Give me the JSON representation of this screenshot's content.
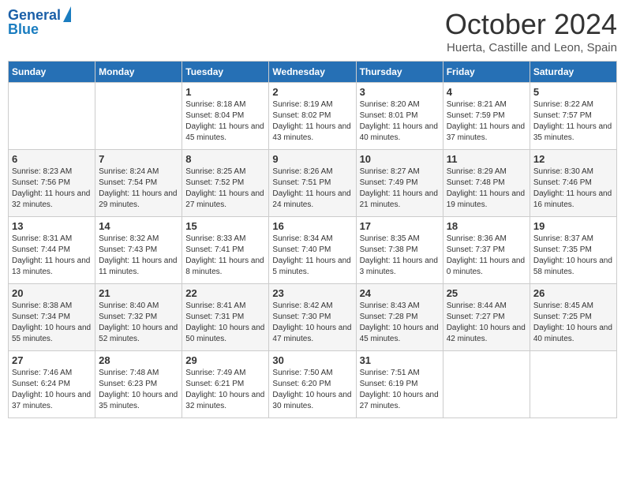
{
  "header": {
    "logo_line1": "General",
    "logo_line2": "Blue",
    "month_title": "October 2024",
    "location": "Huerta, Castille and Leon, Spain"
  },
  "days_of_week": [
    "Sunday",
    "Monday",
    "Tuesday",
    "Wednesday",
    "Thursday",
    "Friday",
    "Saturday"
  ],
  "weeks": [
    [
      {
        "day": "",
        "info": ""
      },
      {
        "day": "",
        "info": ""
      },
      {
        "day": "1",
        "info": "Sunrise: 8:18 AM\nSunset: 8:04 PM\nDaylight: 11 hours and 45 minutes."
      },
      {
        "day": "2",
        "info": "Sunrise: 8:19 AM\nSunset: 8:02 PM\nDaylight: 11 hours and 43 minutes."
      },
      {
        "day": "3",
        "info": "Sunrise: 8:20 AM\nSunset: 8:01 PM\nDaylight: 11 hours and 40 minutes."
      },
      {
        "day": "4",
        "info": "Sunrise: 8:21 AM\nSunset: 7:59 PM\nDaylight: 11 hours and 37 minutes."
      },
      {
        "day": "5",
        "info": "Sunrise: 8:22 AM\nSunset: 7:57 PM\nDaylight: 11 hours and 35 minutes."
      }
    ],
    [
      {
        "day": "6",
        "info": "Sunrise: 8:23 AM\nSunset: 7:56 PM\nDaylight: 11 hours and 32 minutes."
      },
      {
        "day": "7",
        "info": "Sunrise: 8:24 AM\nSunset: 7:54 PM\nDaylight: 11 hours and 29 minutes."
      },
      {
        "day": "8",
        "info": "Sunrise: 8:25 AM\nSunset: 7:52 PM\nDaylight: 11 hours and 27 minutes."
      },
      {
        "day": "9",
        "info": "Sunrise: 8:26 AM\nSunset: 7:51 PM\nDaylight: 11 hours and 24 minutes."
      },
      {
        "day": "10",
        "info": "Sunrise: 8:27 AM\nSunset: 7:49 PM\nDaylight: 11 hours and 21 minutes."
      },
      {
        "day": "11",
        "info": "Sunrise: 8:29 AM\nSunset: 7:48 PM\nDaylight: 11 hours and 19 minutes."
      },
      {
        "day": "12",
        "info": "Sunrise: 8:30 AM\nSunset: 7:46 PM\nDaylight: 11 hours and 16 minutes."
      }
    ],
    [
      {
        "day": "13",
        "info": "Sunrise: 8:31 AM\nSunset: 7:44 PM\nDaylight: 11 hours and 13 minutes."
      },
      {
        "day": "14",
        "info": "Sunrise: 8:32 AM\nSunset: 7:43 PM\nDaylight: 11 hours and 11 minutes."
      },
      {
        "day": "15",
        "info": "Sunrise: 8:33 AM\nSunset: 7:41 PM\nDaylight: 11 hours and 8 minutes."
      },
      {
        "day": "16",
        "info": "Sunrise: 8:34 AM\nSunset: 7:40 PM\nDaylight: 11 hours and 5 minutes."
      },
      {
        "day": "17",
        "info": "Sunrise: 8:35 AM\nSunset: 7:38 PM\nDaylight: 11 hours and 3 minutes."
      },
      {
        "day": "18",
        "info": "Sunrise: 8:36 AM\nSunset: 7:37 PM\nDaylight: 11 hours and 0 minutes."
      },
      {
        "day": "19",
        "info": "Sunrise: 8:37 AM\nSunset: 7:35 PM\nDaylight: 10 hours and 58 minutes."
      }
    ],
    [
      {
        "day": "20",
        "info": "Sunrise: 8:38 AM\nSunset: 7:34 PM\nDaylight: 10 hours and 55 minutes."
      },
      {
        "day": "21",
        "info": "Sunrise: 8:40 AM\nSunset: 7:32 PM\nDaylight: 10 hours and 52 minutes."
      },
      {
        "day": "22",
        "info": "Sunrise: 8:41 AM\nSunset: 7:31 PM\nDaylight: 10 hours and 50 minutes."
      },
      {
        "day": "23",
        "info": "Sunrise: 8:42 AM\nSunset: 7:30 PM\nDaylight: 10 hours and 47 minutes."
      },
      {
        "day": "24",
        "info": "Sunrise: 8:43 AM\nSunset: 7:28 PM\nDaylight: 10 hours and 45 minutes."
      },
      {
        "day": "25",
        "info": "Sunrise: 8:44 AM\nSunset: 7:27 PM\nDaylight: 10 hours and 42 minutes."
      },
      {
        "day": "26",
        "info": "Sunrise: 8:45 AM\nSunset: 7:25 PM\nDaylight: 10 hours and 40 minutes."
      }
    ],
    [
      {
        "day": "27",
        "info": "Sunrise: 7:46 AM\nSunset: 6:24 PM\nDaylight: 10 hours and 37 minutes."
      },
      {
        "day": "28",
        "info": "Sunrise: 7:48 AM\nSunset: 6:23 PM\nDaylight: 10 hours and 35 minutes."
      },
      {
        "day": "29",
        "info": "Sunrise: 7:49 AM\nSunset: 6:21 PM\nDaylight: 10 hours and 32 minutes."
      },
      {
        "day": "30",
        "info": "Sunrise: 7:50 AM\nSunset: 6:20 PM\nDaylight: 10 hours and 30 minutes."
      },
      {
        "day": "31",
        "info": "Sunrise: 7:51 AM\nSunset: 6:19 PM\nDaylight: 10 hours and 27 minutes."
      },
      {
        "day": "",
        "info": ""
      },
      {
        "day": "",
        "info": ""
      }
    ]
  ]
}
